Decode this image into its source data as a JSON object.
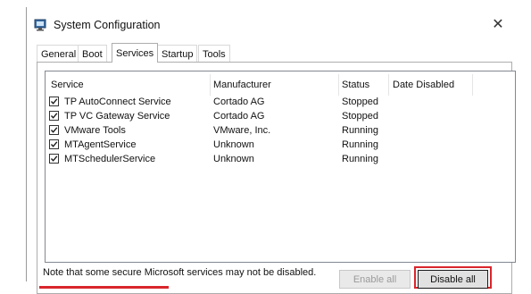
{
  "window": {
    "title": "System Configuration",
    "close_glyph": "✕"
  },
  "tabs": [
    {
      "label": "General",
      "active": false
    },
    {
      "label": "Boot",
      "active": false
    },
    {
      "label": "Services",
      "active": true
    },
    {
      "label": "Startup",
      "active": false
    },
    {
      "label": "Tools",
      "active": false
    }
  ],
  "table": {
    "columns": [
      "Service",
      "Manufacturer",
      "Status",
      "Date Disabled"
    ],
    "rows": [
      {
        "checked": true,
        "service": "TP AutoConnect Service",
        "manufacturer": "Cortado AG",
        "status": "Stopped",
        "date_disabled": ""
      },
      {
        "checked": true,
        "service": "TP VC Gateway Service",
        "manufacturer": "Cortado AG",
        "status": "Stopped",
        "date_disabled": ""
      },
      {
        "checked": true,
        "service": "VMware Tools",
        "manufacturer": "VMware, Inc.",
        "status": "Running",
        "date_disabled": ""
      },
      {
        "checked": true,
        "service": "MTAgentService",
        "manufacturer": "Unknown",
        "status": "Running",
        "date_disabled": ""
      },
      {
        "checked": true,
        "service": "MTSchedulerService",
        "manufacturer": "Unknown",
        "status": "Running",
        "date_disabled": ""
      }
    ]
  },
  "footer": {
    "note": "Note that some secure Microsoft services may not be disabled.",
    "enable_all_label": "Enable all",
    "disable_all_label": "Disable all"
  },
  "colors": {
    "highlight": "#d9262c",
    "accent": "#0078d7"
  },
  "icons": {
    "title": "system-config-icon",
    "close": "close-icon",
    "check": "checkmark-icon"
  }
}
